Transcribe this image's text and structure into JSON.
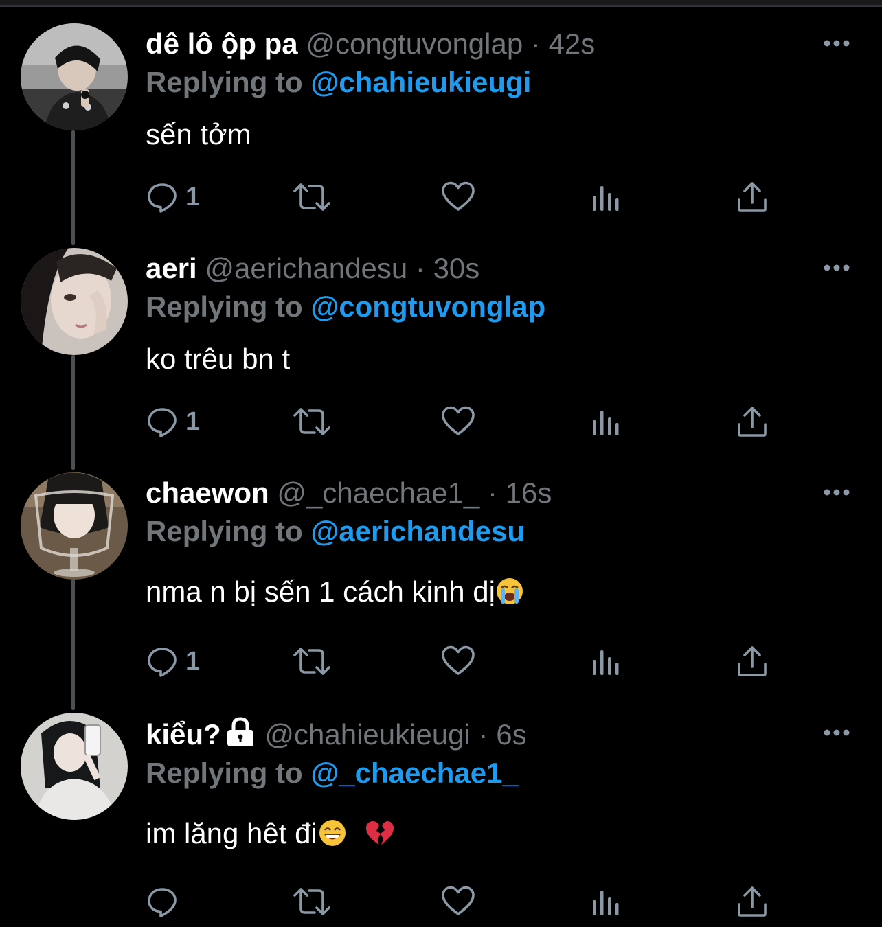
{
  "colors": {
    "background": "#000000",
    "text_primary": "#ffffff",
    "text_secondary": "#71767b",
    "accent": "#1d9bf0",
    "thread_line": "#4a4f54"
  },
  "tweets": [
    {
      "display_name": "dê lô ộp pa",
      "handle": "@congtuvonglap",
      "separator": "·",
      "time": "42s",
      "reply_prefix": "Replying to",
      "reply_to": "@chahieukieugi",
      "text": "sến tởm",
      "reply_count": "1",
      "protected": false
    },
    {
      "display_name": "aeri",
      "handle": "@aerichandesu",
      "separator": "·",
      "time": "30s",
      "reply_prefix": "Replying to",
      "reply_to": "@congtuvonglap",
      "text": "ko trêu bn t",
      "reply_count": "1",
      "protected": false
    },
    {
      "display_name": "chaewon",
      "handle": "@_chaechae1_",
      "separator": "·",
      "time": "16s",
      "reply_prefix": "Replying to",
      "reply_to": "@aerichandesu",
      "text": "nma n bị sến 1 cách kinh dị",
      "text_emoji": "loudly-crying-face",
      "reply_count": "1",
      "protected": false
    },
    {
      "display_name": "kiểu?",
      "handle": "@chahieukieugi",
      "separator": "·",
      "time": "6s",
      "reply_prefix": "Replying to",
      "reply_to": "@_chaechae1_",
      "text": "im lăng hêt đi",
      "text_emoji": "grinning-face-with-smiling-eyes",
      "text_emoji_2": "broken-heart",
      "reply_count": "",
      "protected": true
    }
  ]
}
